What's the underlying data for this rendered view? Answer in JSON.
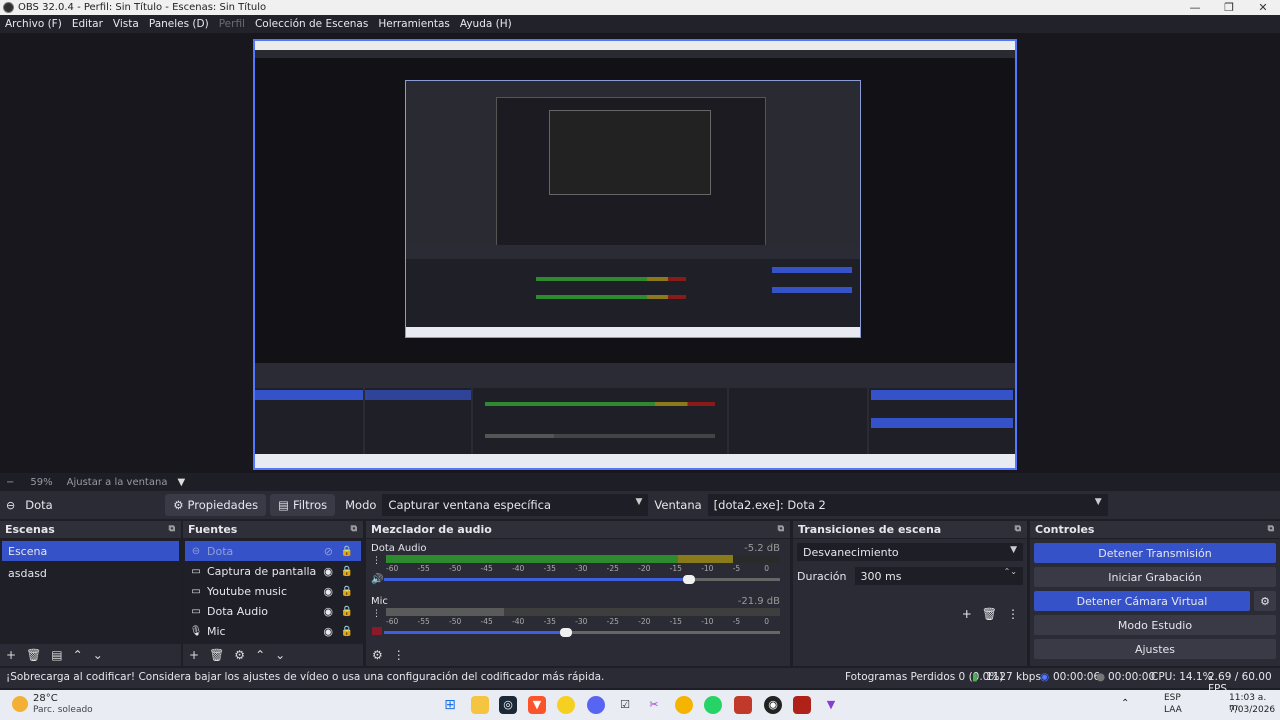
{
  "window": {
    "title": "OBS 32.0.4 - Perfil: Sin Título - Escenas: Sin Título"
  },
  "menu": [
    "Archivo (F)",
    "Editar",
    "Vista",
    "Paneles (D)",
    "Perfil",
    "Colección de Escenas",
    "Herramientas",
    "Ayuda (H)"
  ],
  "zoom": {
    "minus": "−",
    "value": "59%",
    "fit_label": "Ajustar a la ventana"
  },
  "toolbar": {
    "source_name": "Dota",
    "properties": "Propiedades",
    "filters": "Filtros",
    "mode_label": "Modo",
    "mode_value": "Capturar ventana específica",
    "window_label": "Ventana",
    "window_value": "[dota2.exe]: Dota 2"
  },
  "scenes": {
    "title": "Escenas",
    "items": [
      "Escena",
      "asdasd"
    ]
  },
  "sources": {
    "title": "Fuentes",
    "items": [
      "Dota",
      "Captura de pantalla",
      "Youtube music",
      "Dota Audio",
      "Mic"
    ]
  },
  "mixer": {
    "title": "Mezclador de audio",
    "channels": [
      {
        "name": "Dota Audio",
        "db": "-5.2 dB",
        "level": 0.88,
        "volume": 0.77
      },
      {
        "name": "Mic",
        "db": "-21.9 dB",
        "level": 0.0,
        "volume": 0.46
      }
    ],
    "scale": [
      "-60",
      "-55",
      "-50",
      "-45",
      "-40",
      "-35",
      "-30",
      "-25",
      "-20",
      "-15",
      "-10",
      "-5",
      "0"
    ]
  },
  "transitions": {
    "title": "Transiciones de escena",
    "type": "Desvanecimiento",
    "duration_label": "Duración",
    "duration_value": "300 ms"
  },
  "controls": {
    "title": "Controles",
    "stop_stream": "Detener Transmisión",
    "start_record": "Iniciar Grabación",
    "stop_vcam": "Detener Cámara Virtual",
    "studio_mode": "Modo Estudio",
    "settings": "Ajustes"
  },
  "status": {
    "warning": "¡Sobrecarga al codificar! Considera bajar los ajustes de vídeo o usa una configuración del codificador más rápida.",
    "dropped": "Fotogramas Perdidos 0 (0.0%)",
    "bitrate": "1127 kbps",
    "stream_time": "00:00:06",
    "rec_time": "00:00:00",
    "cpu": "CPU: 14.1%",
    "fps": "2.69 / 60.00 FPS"
  },
  "taskbar": {
    "weather_temp": "28°C",
    "weather_desc": "Parc. soleado",
    "lang1": "ESP",
    "lang2": "LAA",
    "time": "11:03 a. m.",
    "date": "7/03/2026"
  },
  "colors": {
    "accent": "#3652c9",
    "dock": "#2b2b35",
    "panel": "#1f1f27"
  }
}
